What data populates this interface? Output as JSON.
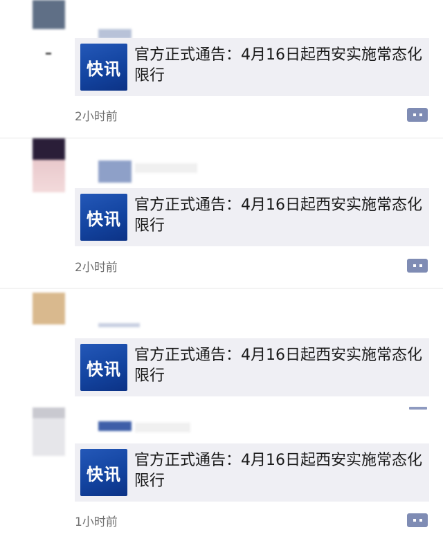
{
  "colors": {
    "accent": "#7f8cb4",
    "card_bg": "#efeff4",
    "thumb_blue": "#1748a8",
    "time_text": "#6e6e6e"
  },
  "posts": [
    {
      "thumb_label": "快讯",
      "card_title": "官方正式通告：4月16日起西安实施常态化限行",
      "time": "2小时前",
      "icon": "comment-icon"
    },
    {
      "thumb_label": "快讯",
      "card_title": "官方正式通告：4月16日起西安实施常态化限行",
      "time": "2小时前",
      "icon": "comment-icon"
    },
    {
      "thumb_label": "快讯",
      "card_title": "官方正式通告：4月16日起西安实施常态化限行",
      "time": "",
      "icon": "comment-icon"
    },
    {
      "thumb_label": "快讯",
      "card_title": "官方正式通告：4月16日起西安实施常态化限行",
      "time": "1小时前",
      "icon": "comment-icon"
    }
  ]
}
